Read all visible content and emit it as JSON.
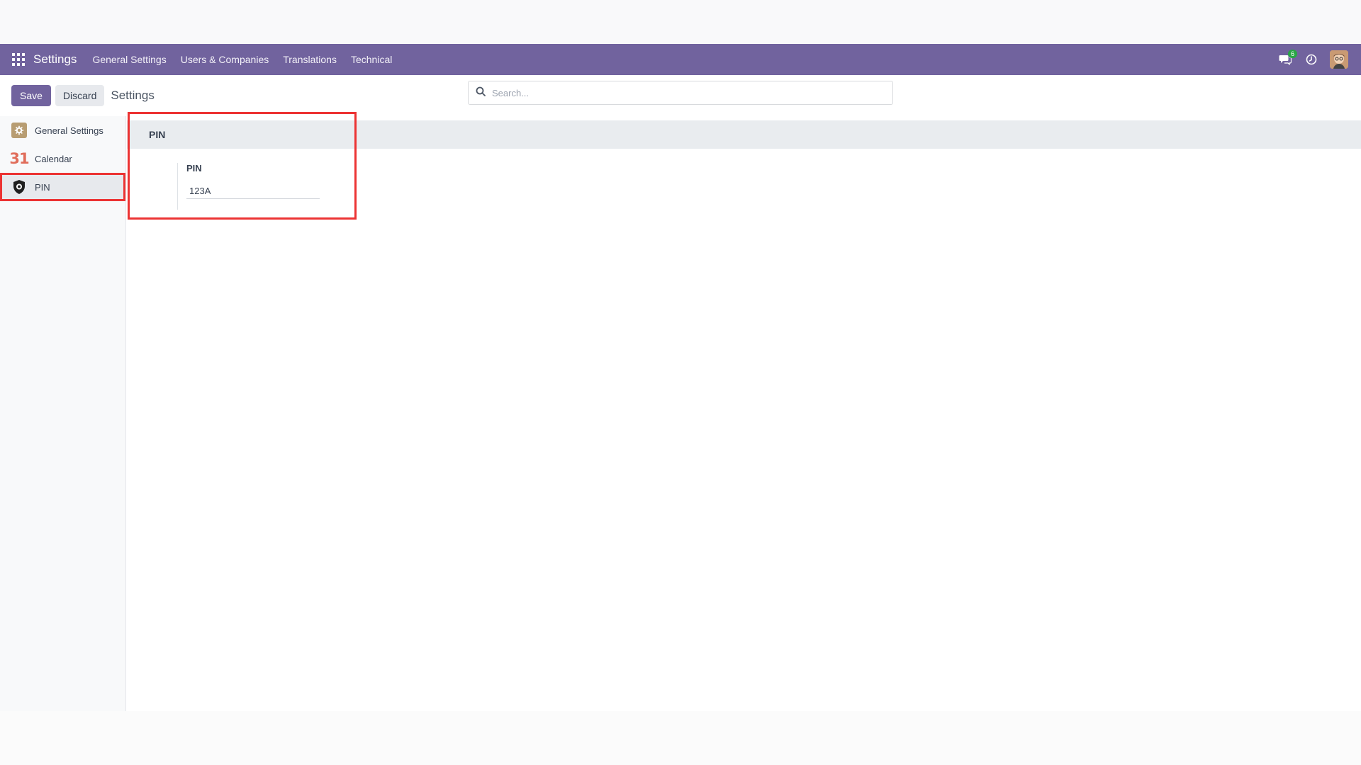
{
  "navbar": {
    "brand": "Settings",
    "menu": [
      "General Settings",
      "Users & Companies",
      "Translations",
      "Technical"
    ],
    "messages_badge": "6",
    "color": "#71639e"
  },
  "control_panel": {
    "save_label": "Save",
    "discard_label": "Discard",
    "breadcrumb": "Settings",
    "search_placeholder": "Search..."
  },
  "sidebar": {
    "items": [
      {
        "label": "General Settings",
        "icon": "gear-icon"
      },
      {
        "label": "Calendar",
        "icon": "calendar-icon",
        "icon_text": "31"
      },
      {
        "label": "PIN",
        "icon": "shield-icon",
        "active": true
      }
    ]
  },
  "main": {
    "section_title": "PIN",
    "field_label": "PIN",
    "field_value": "123A"
  },
  "colors": {
    "highlight": "#ec3333",
    "accent": "#71639e"
  }
}
